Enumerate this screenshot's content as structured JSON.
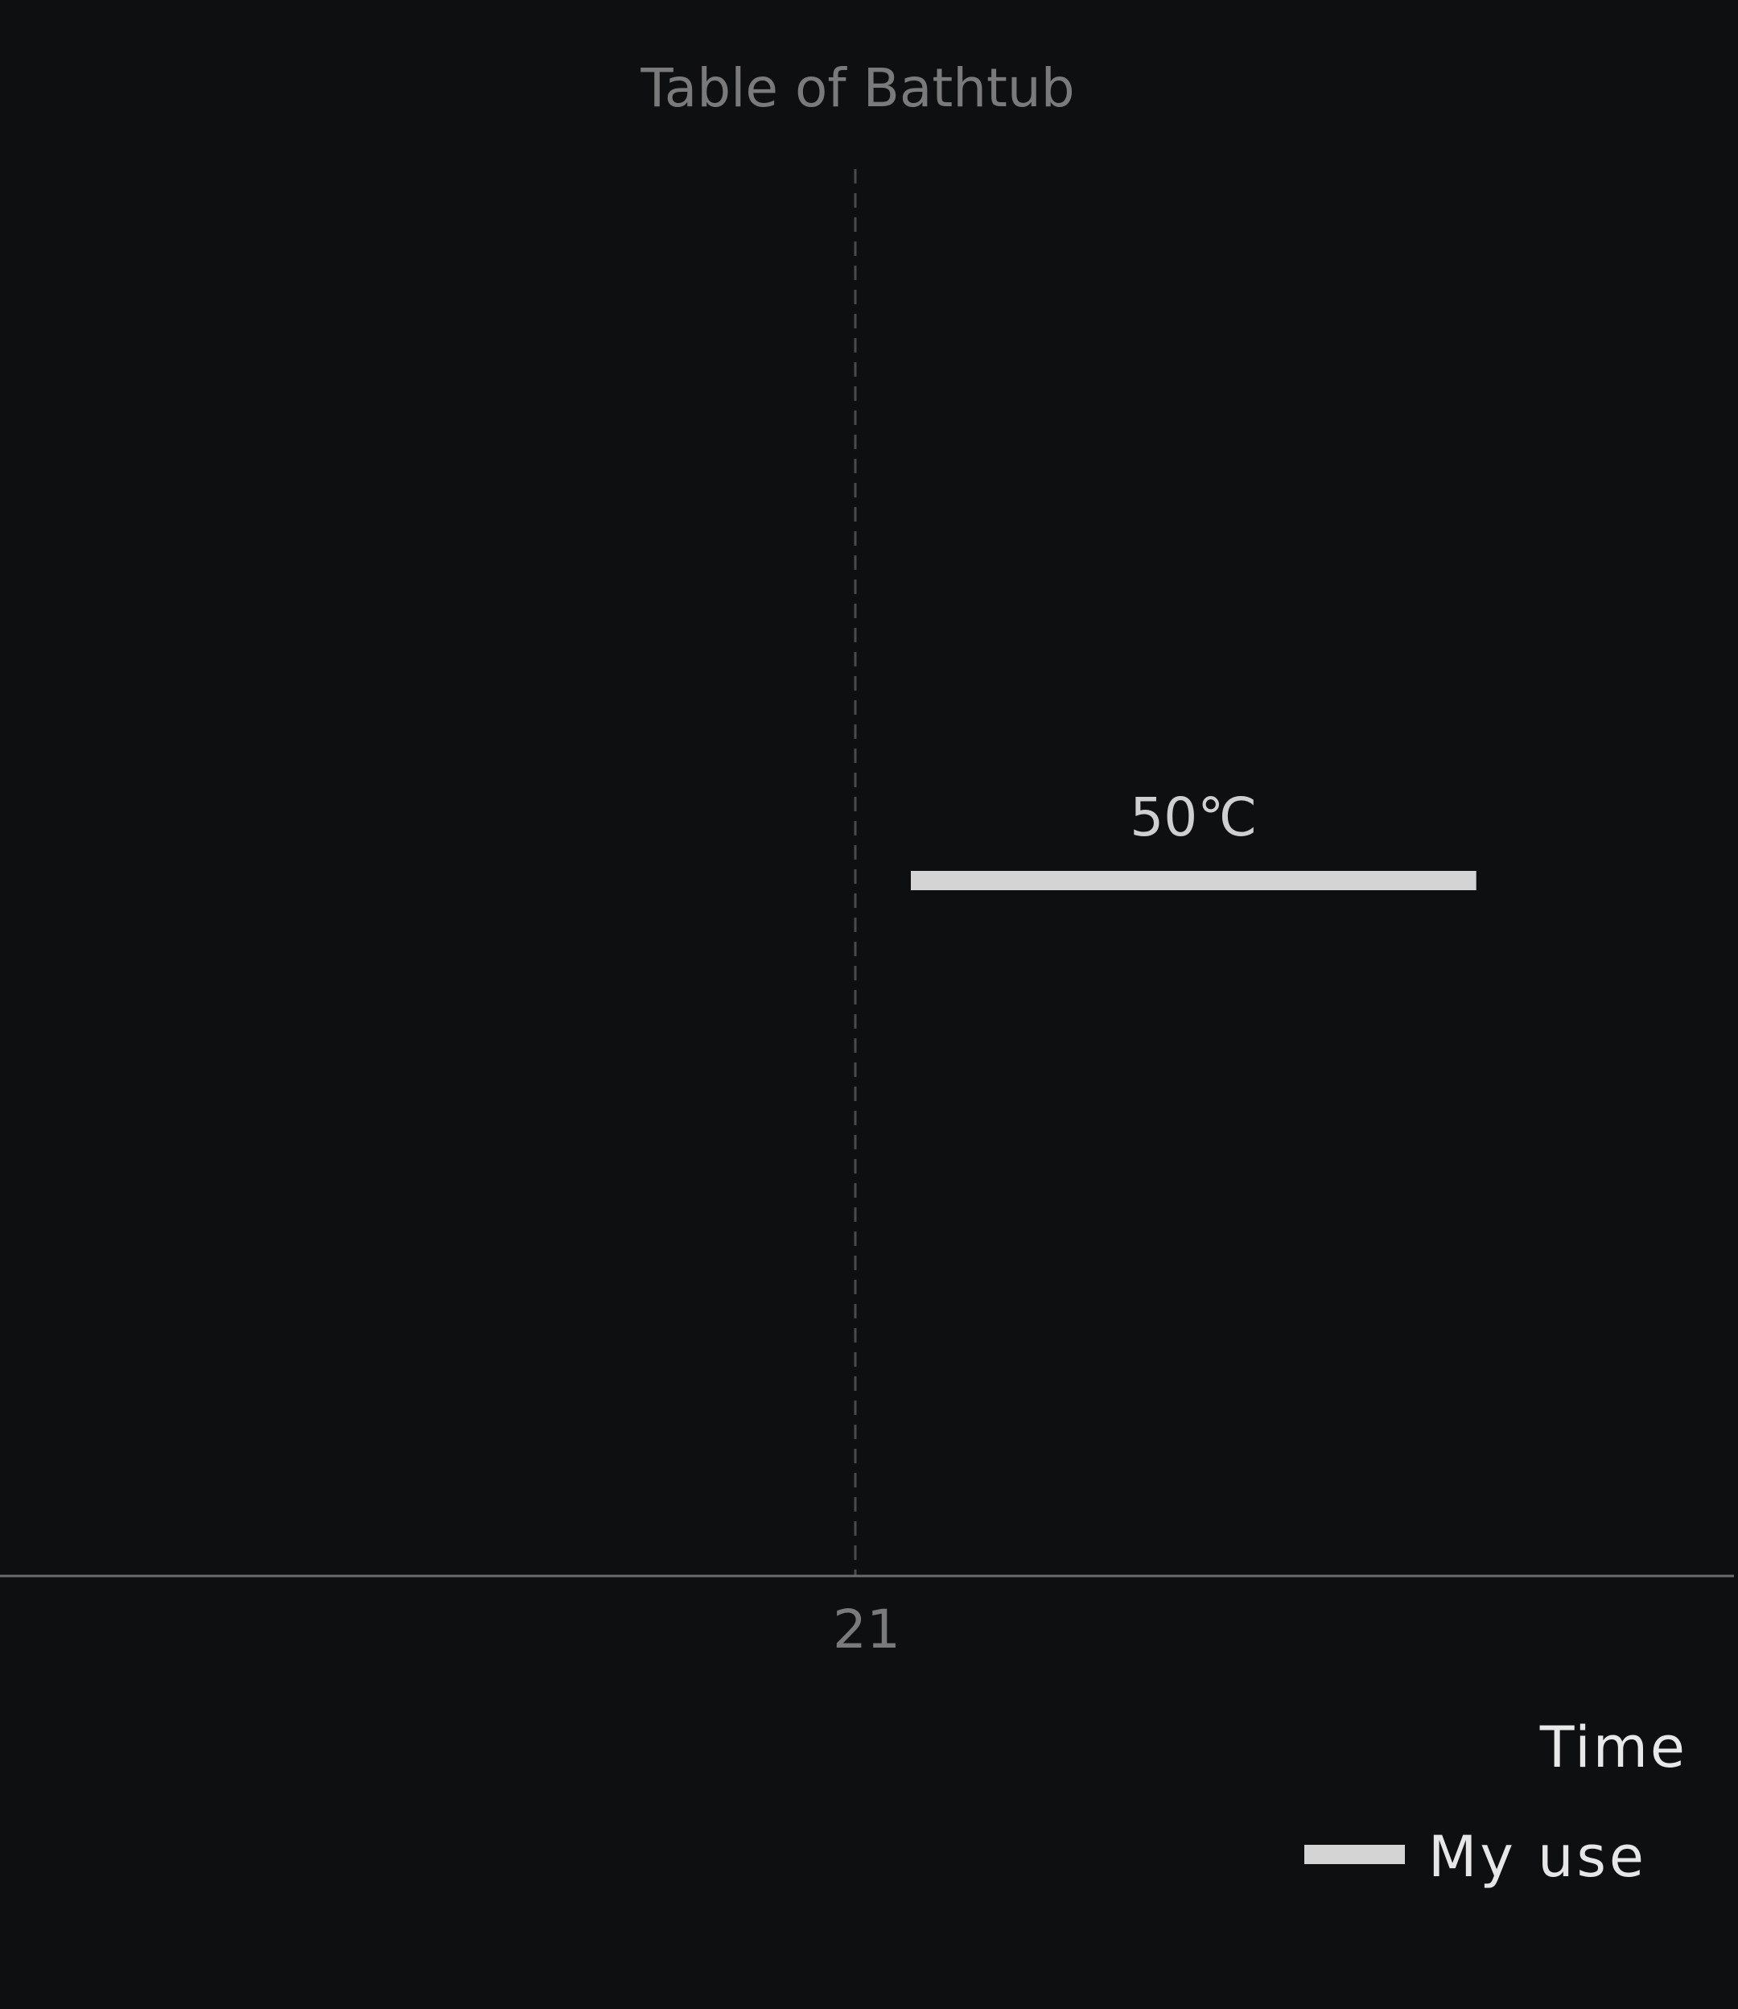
{
  "chart_data": {
    "type": "line",
    "title": "Table of Bathtub",
    "xlabel": "Time",
    "ylabel": "",
    "x_ticks": [
      "21"
    ],
    "series": [
      {
        "name": "My use",
        "color": "#d4d4d4",
        "segments": [
          {
            "x_start": 21,
            "x_end": 21.55,
            "y": 50,
            "label": "50℃"
          }
        ]
      }
    ],
    "grid": false,
    "reference_line": {
      "x": 21,
      "style": "dashed"
    },
    "legend_position": "bottom-right",
    "colors": {
      "background": "#0e0f11",
      "title": "#7a7a7a",
      "axis": "#6b6b6b",
      "dashed_line": "#4a4a4a",
      "series": "#d4d4d4"
    }
  }
}
